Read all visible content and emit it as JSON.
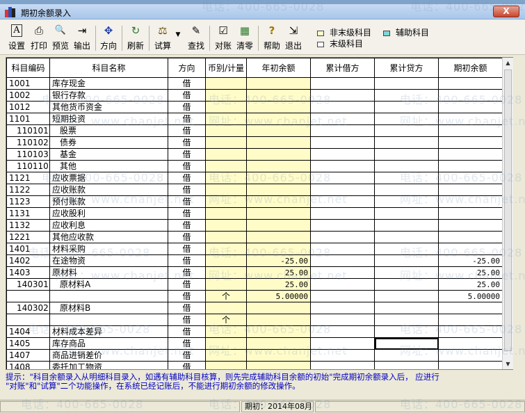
{
  "window": {
    "title": "期初余额录入",
    "close_label": "X"
  },
  "toolbar": {
    "buttons": [
      {
        "label": "设置",
        "icon": "A"
      },
      {
        "label": "打印",
        "icon": "⎙"
      },
      {
        "label": "预览",
        "icon": "🔍"
      },
      {
        "label": "输出",
        "icon": "⇥"
      },
      {
        "label": "方向",
        "icon": "✥"
      },
      {
        "label": "刷新",
        "icon": "↻"
      },
      {
        "label": "试算",
        "icon": "⚖"
      },
      {
        "label": "查找",
        "icon": "✎"
      },
      {
        "label": "对账",
        "icon": "☑"
      },
      {
        "label": "清零",
        "icon": "▦"
      },
      {
        "label": "帮助",
        "icon": "?"
      },
      {
        "label": "退出",
        "icon": "⇲"
      }
    ],
    "dropdown_arrow": "▼"
  },
  "legend": [
    {
      "label": "非末级科目",
      "color": "#fffcc8"
    },
    {
      "label": "辅助科目",
      "color": "#7fd6d6"
    },
    {
      "label": "末级科目",
      "color": "#ffffff"
    }
  ],
  "table": {
    "headers": [
      "科目编码",
      "科目名称",
      "方向",
      "币别/计量",
      "年初余额",
      "累计借方",
      "累计贷方",
      "期初余额"
    ],
    "rows": [
      {
        "code": "1001",
        "name": "库存现金",
        "dir": "借",
        "cur": "",
        "begin": "",
        "debit": "",
        "credit": "",
        "bal": "",
        "indent": 0
      },
      {
        "code": "1002",
        "name": "银行存款",
        "dir": "借",
        "cur": "",
        "begin": "",
        "debit": "",
        "credit": "",
        "bal": "",
        "indent": 0
      },
      {
        "code": "1012",
        "name": "其他货币资金",
        "dir": "借",
        "cur": "",
        "begin": "",
        "debit": "",
        "credit": "",
        "bal": "",
        "indent": 0
      },
      {
        "code": "1101",
        "name": "短期投资",
        "dir": "借",
        "cur": "",
        "begin": "",
        "debit": "",
        "credit": "",
        "bal": "",
        "indent": 0
      },
      {
        "code": "110101",
        "name": "股票",
        "dir": "借",
        "cur": "",
        "begin": "",
        "debit": "",
        "credit": "",
        "bal": "",
        "indent": 1
      },
      {
        "code": "110102",
        "name": "债券",
        "dir": "借",
        "cur": "",
        "begin": "",
        "debit": "",
        "credit": "",
        "bal": "",
        "indent": 1
      },
      {
        "code": "110103",
        "name": "基金",
        "dir": "借",
        "cur": "",
        "begin": "",
        "debit": "",
        "credit": "",
        "bal": "",
        "indent": 1
      },
      {
        "code": "110110",
        "name": "其他",
        "dir": "借",
        "cur": "",
        "begin": "",
        "debit": "",
        "credit": "",
        "bal": "",
        "indent": 1
      },
      {
        "code": "1121",
        "name": "应收票据",
        "dir": "借",
        "cur": "",
        "begin": "",
        "debit": "",
        "credit": "",
        "bal": "",
        "indent": 0
      },
      {
        "code": "1122",
        "name": "应收账款",
        "dir": "借",
        "cur": "",
        "begin": "",
        "debit": "",
        "credit": "",
        "bal": "",
        "indent": 0
      },
      {
        "code": "1123",
        "name": "预付账款",
        "dir": "借",
        "cur": "",
        "begin": "",
        "debit": "",
        "credit": "",
        "bal": "",
        "indent": 0
      },
      {
        "code": "1131",
        "name": "应收股利",
        "dir": "借",
        "cur": "",
        "begin": "",
        "debit": "",
        "credit": "",
        "bal": "",
        "indent": 0
      },
      {
        "code": "1132",
        "name": "应收利息",
        "dir": "借",
        "cur": "",
        "begin": "",
        "debit": "",
        "credit": "",
        "bal": "",
        "indent": 0
      },
      {
        "code": "1221",
        "name": "其他应收款",
        "dir": "借",
        "cur": "",
        "begin": "",
        "debit": "",
        "credit": "",
        "bal": "",
        "indent": 0
      },
      {
        "code": "1401",
        "name": "材料采购",
        "dir": "借",
        "cur": "",
        "begin": "",
        "debit": "",
        "credit": "",
        "bal": "",
        "indent": 0
      },
      {
        "code": "1402",
        "name": "在途物资",
        "dir": "借",
        "cur": "",
        "begin": "-25.00",
        "debit": "",
        "credit": "",
        "bal": "-25.00",
        "indent": 0
      },
      {
        "code": "1403",
        "name": "原材料",
        "dir": "借",
        "cur": "",
        "begin": "25.00",
        "debit": "",
        "credit": "",
        "bal": "25.00",
        "indent": 0
      },
      {
        "code": "140301",
        "name": "原材料A",
        "dir": "借",
        "cur": "",
        "begin": "25.00",
        "debit": "",
        "credit": "",
        "bal": "25.00",
        "indent": 1
      },
      {
        "code": "",
        "name": "",
        "dir": "借",
        "cur": "个",
        "begin": "5.00000",
        "debit": "",
        "credit": "",
        "bal": "5.00000",
        "indent": 0
      },
      {
        "code": "140302",
        "name": "原材料B",
        "dir": "借",
        "cur": "",
        "begin": "",
        "debit": "",
        "credit": "",
        "bal": "",
        "indent": 1
      },
      {
        "code": "",
        "name": "",
        "dir": "借",
        "cur": "个",
        "begin": "",
        "debit": "",
        "credit": "",
        "bal": "",
        "indent": 0
      },
      {
        "code": "1404",
        "name": "材料成本差异",
        "dir": "借",
        "cur": "",
        "begin": "",
        "debit": "",
        "credit": "",
        "bal": "",
        "indent": 0
      },
      {
        "code": "1405",
        "name": "库存商品",
        "dir": "借",
        "cur": "",
        "begin": "",
        "debit": "",
        "credit": "",
        "bal": "",
        "indent": 0
      },
      {
        "code": "1407",
        "name": "商品进销差价",
        "dir": "借",
        "cur": "",
        "begin": "",
        "debit": "",
        "credit": "",
        "bal": "",
        "indent": 0
      },
      {
        "code": "1408",
        "name": "委托加工物资",
        "dir": "借",
        "cur": "",
        "begin": "",
        "debit": "",
        "credit": "",
        "bal": "",
        "indent": 0
      }
    ]
  },
  "tip": {
    "line1": "提示：\"科目余额录入从明细科目录入，如遇有辅助科目核算，则先完成辅助科目余额的初始\"完成期初余额录入后，        应进行",
    "line2": "\"对账\"和\"试算\"二个功能操作，在系统已经记账后，不能进行期初余额的修改操作。"
  },
  "status": {
    "period": "期初：2014年08月"
  },
  "watermark": {
    "phone": "电话：400-665-0028",
    "site": "网址：www.chanjet.net"
  }
}
